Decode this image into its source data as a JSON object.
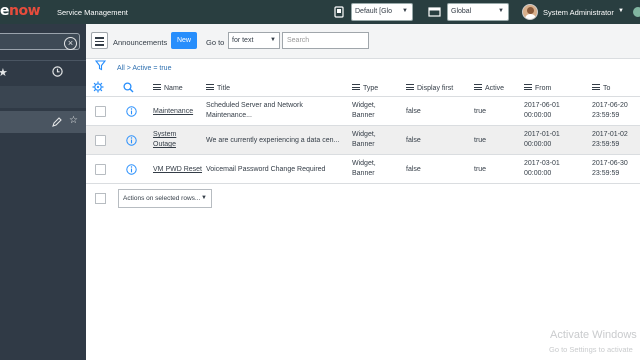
{
  "banner": {
    "logo_tail": "e",
    "logo_accent": "now",
    "title": "Service Management",
    "update_set": "Default [Glo",
    "application": "Global",
    "user_name": "System Administrator"
  },
  "nav": {
    "filter_value": ""
  },
  "listbar": {
    "title": "Announcements",
    "new_label": "New",
    "goto_label": "Go to",
    "goto_field": "for text",
    "search_placeholder": "Search"
  },
  "breadcrumb": "All > Active = true",
  "columns": [
    "Name",
    "Title",
    "Type",
    "Display first",
    "Active",
    "From",
    "To"
  ],
  "rows": [
    {
      "name_lines": [
        "Maintenance"
      ],
      "title_lines": [
        "Scheduled Server and Network",
        "Maintenance..."
      ],
      "type_lines": [
        "Widget,",
        "Banner"
      ],
      "display_first": "false",
      "active": "true",
      "from_lines": [
        "2017-06-01",
        "00:00:00"
      ],
      "to_lines": [
        "2017-06-20",
        "23:59:59"
      ]
    },
    {
      "name_lines": [
        "System",
        "Outage"
      ],
      "title_lines": [
        "We are currently experiencing a data cen..."
      ],
      "type_lines": [
        "Widget,",
        "Banner"
      ],
      "display_first": "false",
      "active": "true",
      "from_lines": [
        "2017-01-01",
        "00:00:00"
      ],
      "to_lines": [
        "2017-01-02",
        "23:59:59"
      ]
    },
    {
      "name_lines": [
        "VM PWD Reset"
      ],
      "title_lines": [
        "Voicemail Password Change Required"
      ],
      "type_lines": [
        "Widget,",
        "Banner"
      ],
      "display_first": "false",
      "active": "true",
      "from_lines": [
        "2017-03-01",
        "00:00:00"
      ],
      "to_lines": [
        "2017-06-30",
        "23:59:59"
      ]
    }
  ],
  "bulk_action": "Actions on selected rows...",
  "watermark": {
    "line1": "Activate Windows",
    "line2": "Go to Settings to activate"
  },
  "colors": {
    "banner": "#293e40",
    "nav": "#303a46",
    "primary_button": "#278efc",
    "logo_accent": "#e74c3c"
  }
}
